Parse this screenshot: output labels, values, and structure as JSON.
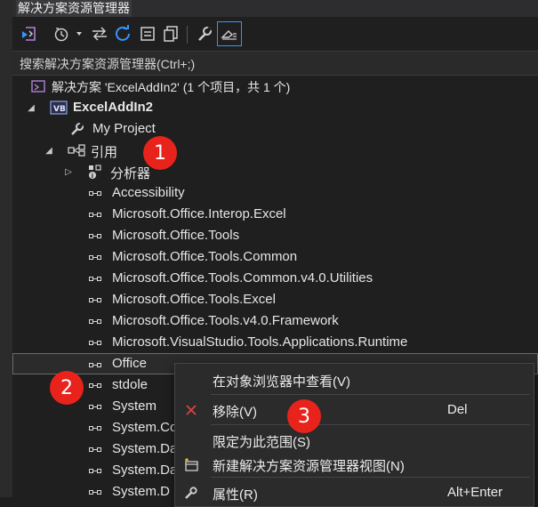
{
  "window": {
    "title": "解决方案资源管理器"
  },
  "search": {
    "placeholder": "搜索解决方案资源管理器(Ctrl+;)"
  },
  "tree": {
    "solution": "解决方案 'ExcelAddIn2' (1 个项目，共 1 个)",
    "project": "ExcelAddIn2",
    "my_project": "My Project",
    "references": "引用",
    "analyzers": "分析器",
    "refs": [
      "Accessibility",
      "Microsoft.Office.Interop.Excel",
      "Microsoft.Office.Tools",
      "Microsoft.Office.Tools.Common",
      "Microsoft.Office.Tools.Common.v4.0.Utilities",
      "Microsoft.Office.Tools.Excel",
      "Microsoft.Office.Tools.v4.0.Framework",
      "Microsoft.VisualStudio.Tools.Applications.Runtime",
      "Office",
      "stdole",
      "System",
      "System.Co",
      "System.Da",
      "System.Da",
      "System.D"
    ]
  },
  "context_menu": {
    "items": [
      {
        "label": "在对象浏览器中查看(V)",
        "shortcut": ""
      },
      {
        "label": "移除(V)",
        "shortcut": "Del"
      },
      {
        "label": "限定为此范围(S)",
        "shortcut": ""
      },
      {
        "label": "新建解决方案资源管理器视图(N)",
        "shortcut": ""
      },
      {
        "label": "属性(R)",
        "shortcut": "Alt+Enter"
      }
    ]
  },
  "annotations": [
    "1",
    "2",
    "3"
  ],
  "colors": {
    "background": "#1f1f1f",
    "accent": "#3794ff",
    "badge": "#e8231b",
    "remove_icon": "#e0443e",
    "selection_border": "#6a6a6a"
  },
  "icons": {
    "toolbar": [
      "vs-switch-view-icon",
      "history-icon",
      "sync-icon",
      "refresh-icon",
      "collapse-all-icon",
      "show-all-files-icon",
      "properties-wrench-icon",
      "preview-selected-icon"
    ]
  }
}
